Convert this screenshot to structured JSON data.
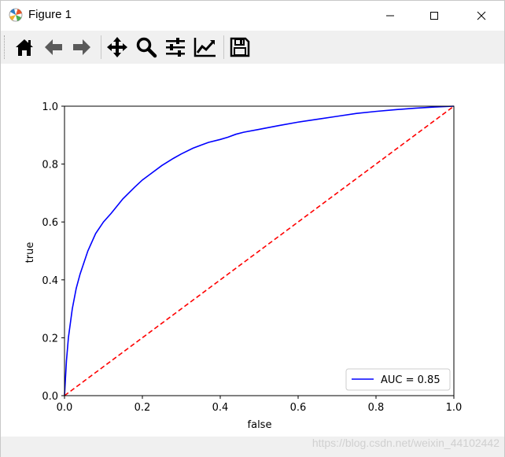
{
  "window": {
    "title": "Figure 1",
    "controls": [
      "minimize",
      "maximize",
      "close"
    ]
  },
  "toolbar": {
    "tools": [
      {
        "name": "home-icon"
      },
      {
        "name": "back-icon"
      },
      {
        "name": "forward-icon"
      },
      {
        "name": "pan-icon"
      },
      {
        "name": "zoom-icon"
      },
      {
        "name": "subplots-icon"
      },
      {
        "name": "edit-axis-icon"
      },
      {
        "name": "save-icon"
      }
    ]
  },
  "watermark": "https://blog.csdn.net/weixin_44102442",
  "chart_data": {
    "type": "line",
    "title": "",
    "xlabel": "false",
    "ylabel": "true",
    "xlim": [
      0,
      1
    ],
    "ylim": [
      0,
      1
    ],
    "xticks": [
      "0.0",
      "0.2",
      "0.4",
      "0.6",
      "0.8",
      "1.0"
    ],
    "yticks": [
      "0.0",
      "0.2",
      "0.4",
      "0.6",
      "0.8",
      "1.0"
    ],
    "grid": false,
    "legend_position": "lower-right",
    "series": [
      {
        "name": "AUC = 0.85",
        "color": "#0000ff",
        "style": "solid",
        "x": [
          0.0,
          0.005,
          0.01,
          0.02,
          0.03,
          0.04,
          0.05,
          0.06,
          0.08,
          0.1,
          0.12,
          0.15,
          0.18,
          0.2,
          0.22,
          0.25,
          0.28,
          0.3,
          0.33,
          0.35,
          0.37,
          0.4,
          0.42,
          0.44,
          0.46,
          0.5,
          0.55,
          0.6,
          0.65,
          0.7,
          0.75,
          0.8,
          0.85,
          0.9,
          0.95,
          1.0
        ],
        "y": [
          0.0,
          0.12,
          0.2,
          0.3,
          0.37,
          0.42,
          0.46,
          0.5,
          0.56,
          0.6,
          0.63,
          0.68,
          0.72,
          0.745,
          0.765,
          0.795,
          0.82,
          0.835,
          0.855,
          0.865,
          0.875,
          0.885,
          0.893,
          0.903,
          0.91,
          0.92,
          0.933,
          0.945,
          0.955,
          0.965,
          0.975,
          0.982,
          0.988,
          0.993,
          0.997,
          1.0
        ]
      },
      {
        "name": "",
        "color": "#ff0000",
        "style": "dashed",
        "x": [
          0,
          1
        ],
        "y": [
          0,
          1
        ]
      }
    ]
  }
}
